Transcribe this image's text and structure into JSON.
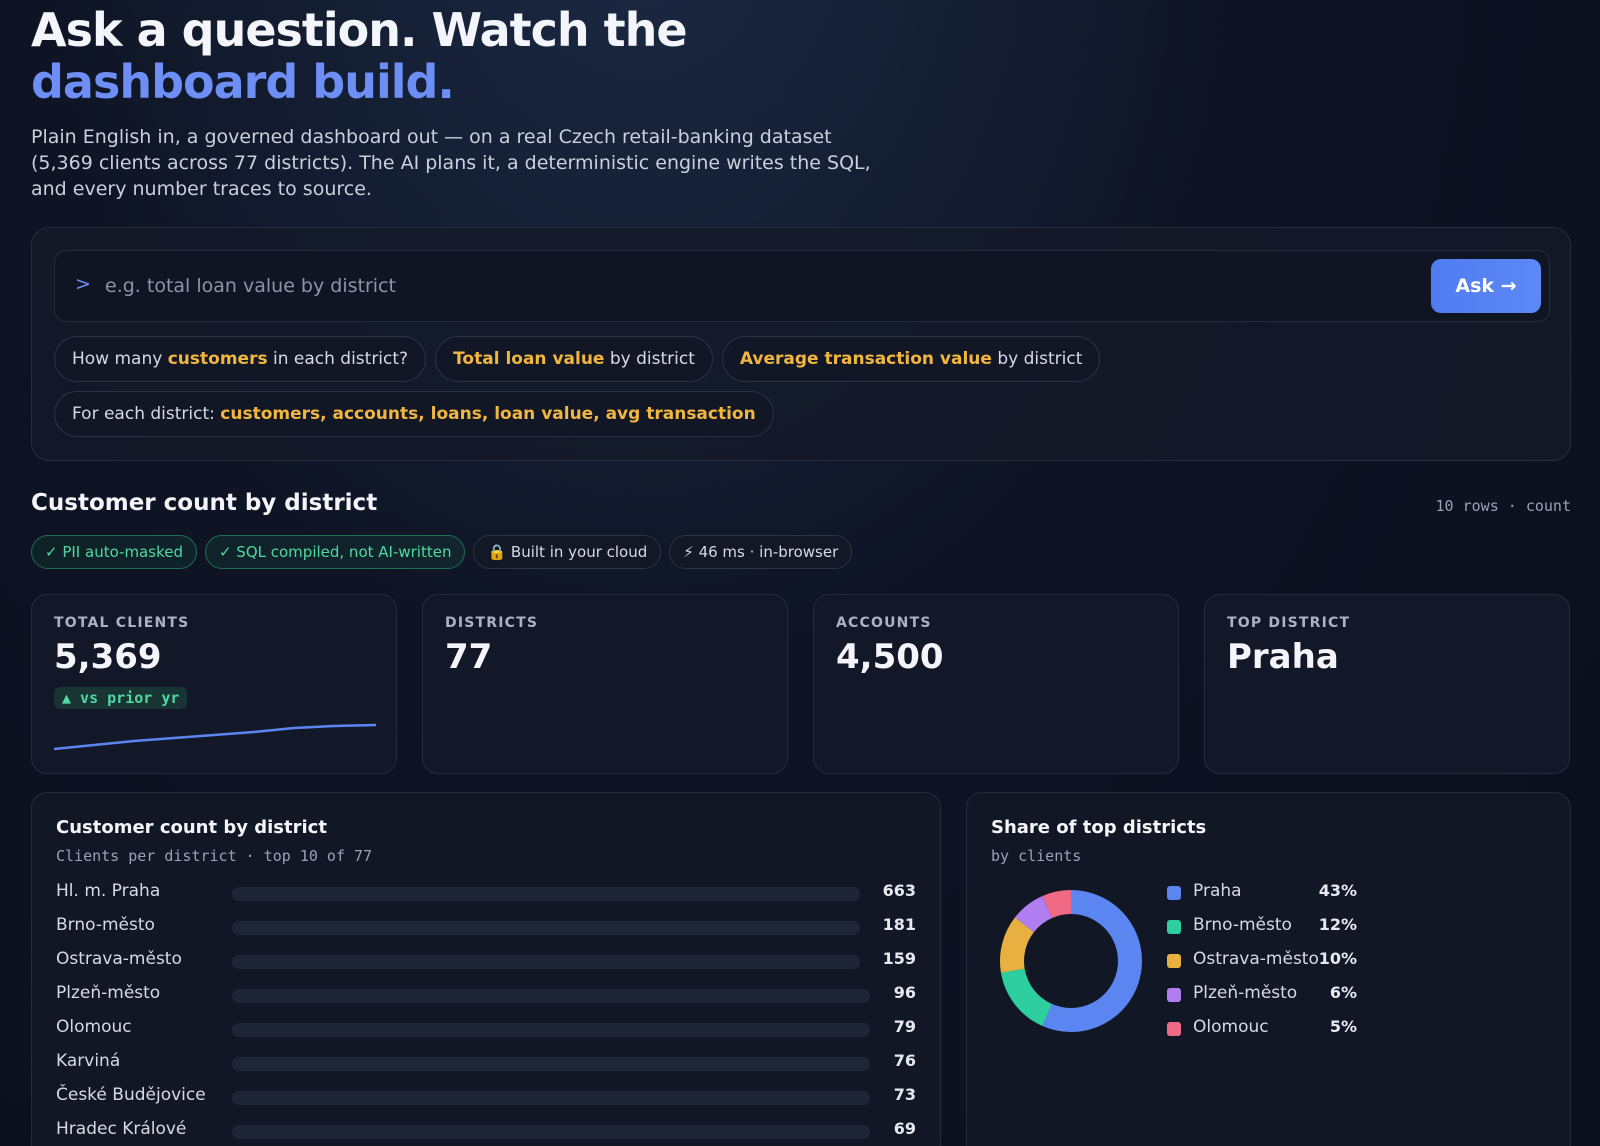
{
  "hero": {
    "title_part1": "Ask a question. Watch the ",
    "title_accent": "dashboard build.",
    "subtitle": "Plain English in, a governed dashboard out — on a real Czech retail-banking dataset (5,369 clients across 77 districts). The AI plans it, a deterministic engine writes the SQL, and every number traces to source."
  },
  "query": {
    "prompt_symbol": ">",
    "placeholder": "e.g. total loan value by district",
    "ask_label": "Ask →"
  },
  "suggestions": [
    {
      "pre": "How many ",
      "hl": "customers",
      "post": " in each district?"
    },
    {
      "pre": "",
      "hl": "Total loan value",
      "post": " by district"
    },
    {
      "pre": "",
      "hl": "Average transaction value",
      "post": " by district"
    },
    {
      "pre": "For each district: ",
      "hl": "customers, accounts, loans, loan value, avg transaction",
      "post": ""
    }
  ],
  "section": {
    "title": "Customer count by district",
    "meta": "10 rows · count"
  },
  "badges": [
    {
      "text": "✓ PII auto-masked",
      "style": "green"
    },
    {
      "text": "✓ SQL compiled, not AI-written",
      "style": "green"
    },
    {
      "text": "🔒 Built in your cloud",
      "style": "neutral"
    },
    {
      "text": "⚡ 46 ms · in-browser",
      "style": "neutral"
    }
  ],
  "kpis": [
    {
      "label": "TOTAL CLIENTS",
      "value": "5,369",
      "trend": "▲ vs prior yr"
    },
    {
      "label": "DISTRICTS",
      "value": "77"
    },
    {
      "label": "ACCOUNTS",
      "value": "4,500"
    },
    {
      "label": "TOP DISTRICT",
      "value": "Praha"
    }
  ],
  "colors": {
    "accent": "#6d8ff5",
    "highlight": "#f1b63f",
    "ok": "#4fd8a0",
    "sparkline": "#5b86f2"
  },
  "chart_data": [
    {
      "type": "bar",
      "title": "Customer count by district",
      "subtitle": "Clients per district · top 10 of 77",
      "categories": [
        "Hl. m. Praha",
        "Brno-město",
        "Ostrava-město",
        "Plzeň-město",
        "Olomouc",
        "Karviná",
        "České Budějovice",
        "Hradec Králové"
      ],
      "values": [
        663,
        181,
        159,
        96,
        79,
        76,
        73,
        69
      ]
    },
    {
      "type": "pie",
      "title": "Share of top districts",
      "subtitle": "by clients",
      "categories": [
        "Praha",
        "Brno-město",
        "Ostrava-město",
        "Plzeň-město",
        "Olomouc"
      ],
      "values": [
        43,
        12,
        10,
        6,
        5
      ],
      "labels": [
        "43%",
        "12%",
        "10%",
        "6%",
        "5%"
      ],
      "colors": [
        "#5b86f2",
        "#2ecf9f",
        "#e8b040",
        "#b07ef0",
        "#f06a86"
      ]
    }
  ]
}
